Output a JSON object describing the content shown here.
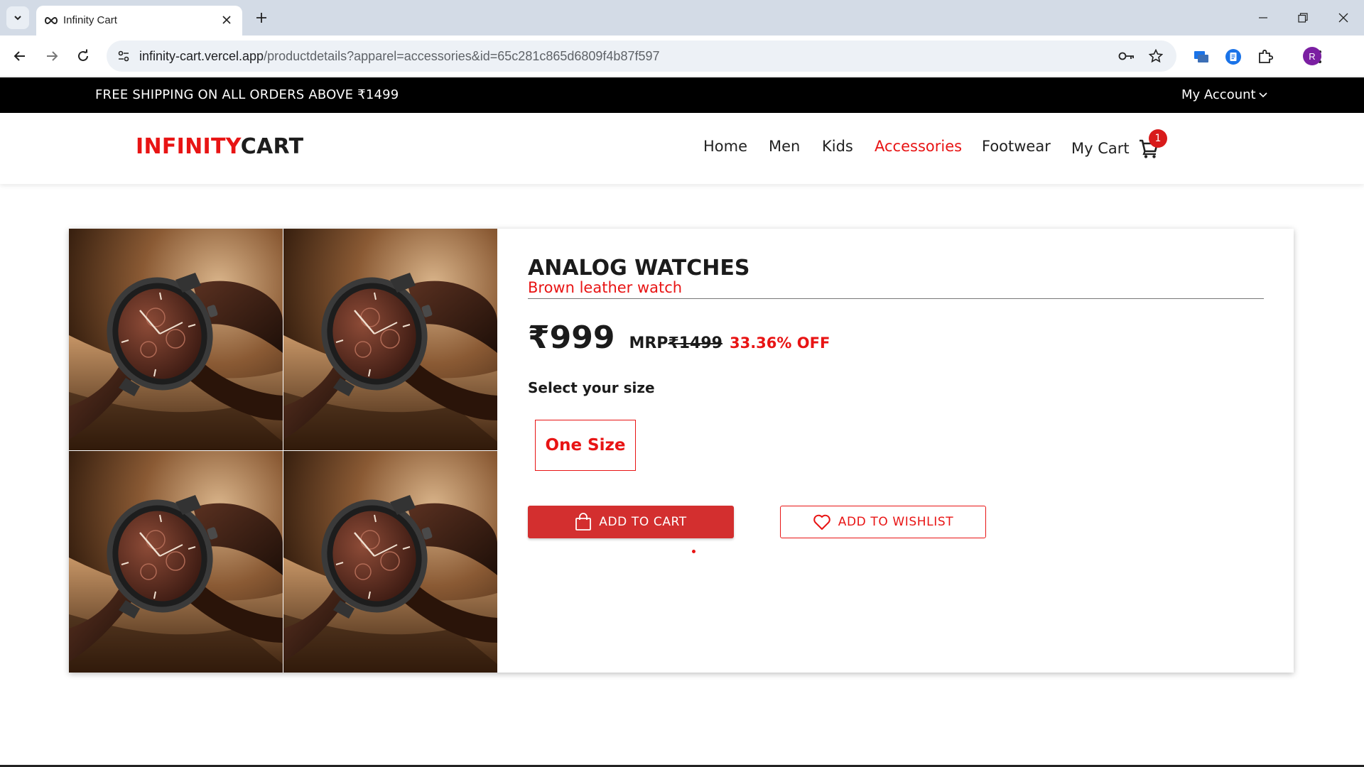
{
  "browser": {
    "tab_title": "Infinity Cart",
    "url_host": "infinity-cart.vercel.app",
    "url_path": "/productdetails?apparel=accessories&id=65c281c865d6809f4b87f597",
    "profile_initial": "R"
  },
  "promo": {
    "text": "FREE SHIPPING ON ALL ORDERS ABOVE ₹1499",
    "account_label": "My Account"
  },
  "header": {
    "logo_red": "INFINITY",
    "logo_dark": "CART",
    "nav": [
      "Home",
      "Men",
      "Kids",
      "Accessories",
      "Footwear"
    ],
    "active_nav": "Accessories",
    "cart_label": "My Cart",
    "cart_count": "1"
  },
  "product": {
    "title": "ANALOG WATCHES",
    "subtitle": "Brown leather watch",
    "price": "₹999",
    "mrp_label": "MRP",
    "mrp_value": "₹1499",
    "discount": "33.36% OFF",
    "size_label": "Select your size",
    "sizes": [
      "One Size"
    ],
    "add_to_cart": "ADD TO CART",
    "add_to_wishlist": "ADD TO WISHLIST"
  },
  "colors": {
    "brand_red": "#e81414",
    "button_red": "#d32f2f",
    "promo_bg": "#000000"
  }
}
